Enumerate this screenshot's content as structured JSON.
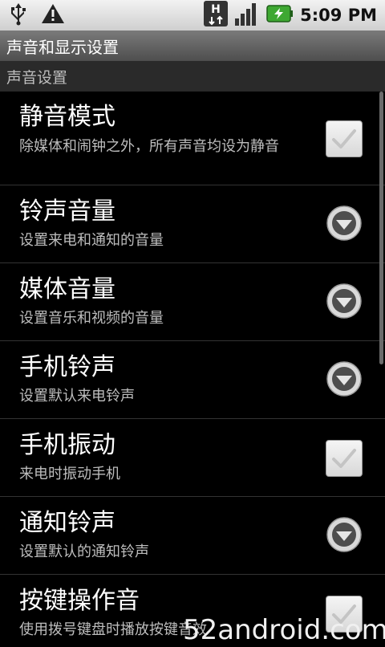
{
  "status_bar": {
    "icons": [
      "usb-icon",
      "warning-icon",
      "hsdpa-icon",
      "signal-icon",
      "battery-charging-icon"
    ],
    "time": "5:09 PM"
  },
  "title_bar": {
    "title": "声音和显示设置"
  },
  "section": {
    "header": "声音设置"
  },
  "settings": [
    {
      "title": "静音模式",
      "summary": "除媒体和闹钟之外，所有声音均设为静音",
      "widget": "checkbox"
    },
    {
      "title": "铃声音量",
      "summary": "设置来电和通知的音量",
      "widget": "dropdown"
    },
    {
      "title": "媒体音量",
      "summary": "设置音乐和视频的音量",
      "widget": "dropdown"
    },
    {
      "title": "手机铃声",
      "summary": "设置默认来电铃声",
      "widget": "dropdown"
    },
    {
      "title": "手机振动",
      "summary": "来电时振动手机",
      "widget": "checkbox"
    },
    {
      "title": "通知铃声",
      "summary": "设置默认的通知铃声",
      "widget": "dropdown"
    },
    {
      "title": "按键操作音",
      "summary": "使用拨号键盘时播放按键音效",
      "widget": "checkbox"
    }
  ],
  "watermark": "52android.com",
  "colors": {
    "background": "#000000",
    "status_bar": "#e0e0e0",
    "title_bar": "#666666",
    "section_header": "#2a2a2a",
    "summary_text": "#bdbdbd",
    "battery_green": "#3ea832"
  }
}
